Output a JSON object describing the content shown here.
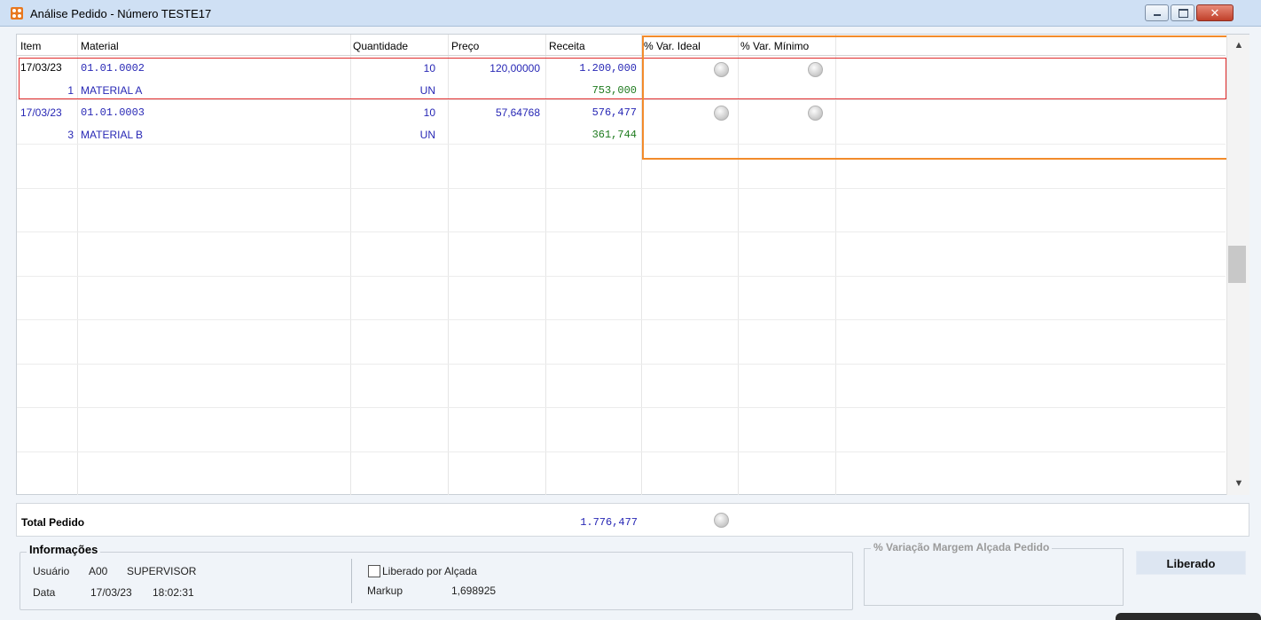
{
  "window": {
    "title": "Análise Pedido - Número TESTE17",
    "close_label": "✕"
  },
  "grid": {
    "columns": [
      "Item",
      "Material",
      "Quantidade",
      "Preço",
      "Receita",
      "% Var. Ideal",
      "% Var. Mínimo"
    ],
    "rows": [
      {
        "date": "17/03/23",
        "item": "1",
        "code": "01.01.0002",
        "material": "MATERIAL A",
        "quantity": "10",
        "unit": "UN",
        "price": "120,00000",
        "revenue": "1.200,000",
        "revenue2": "753,000"
      },
      {
        "date": "17/03/23",
        "item": "3",
        "code": "01.01.0003",
        "material": "MATERIAL B",
        "quantity": "10",
        "unit": "UN",
        "price": "57,64768",
        "revenue": "576,477",
        "revenue2": "361,744"
      }
    ]
  },
  "total": {
    "label": "Total Pedido",
    "value": "1.776,477"
  },
  "info": {
    "title": "Informações",
    "user_label": "Usuário",
    "user_code": "A00",
    "user_name": "SUPERVISOR",
    "date_label": "Data",
    "date": "17/03/23",
    "time": "18:02:31",
    "liberado_checkbox_label": "Liberado por Alçada",
    "liberado_checked": false,
    "markup_label": "Markup",
    "markup_value": "1,698925"
  },
  "variation_panel": {
    "title": "% Variação Margem Alçada Pedido"
  },
  "status_button": {
    "label": "Liberado"
  },
  "icons": {
    "app": "app-logo-icon",
    "scroll_up": "▲",
    "scroll_down": "▼"
  },
  "colors": {
    "highlight_red": "#e02b2b",
    "highlight_orange": "#f28b2b",
    "value_blue": "#2727b5",
    "value_green": "#1d7a1d"
  }
}
